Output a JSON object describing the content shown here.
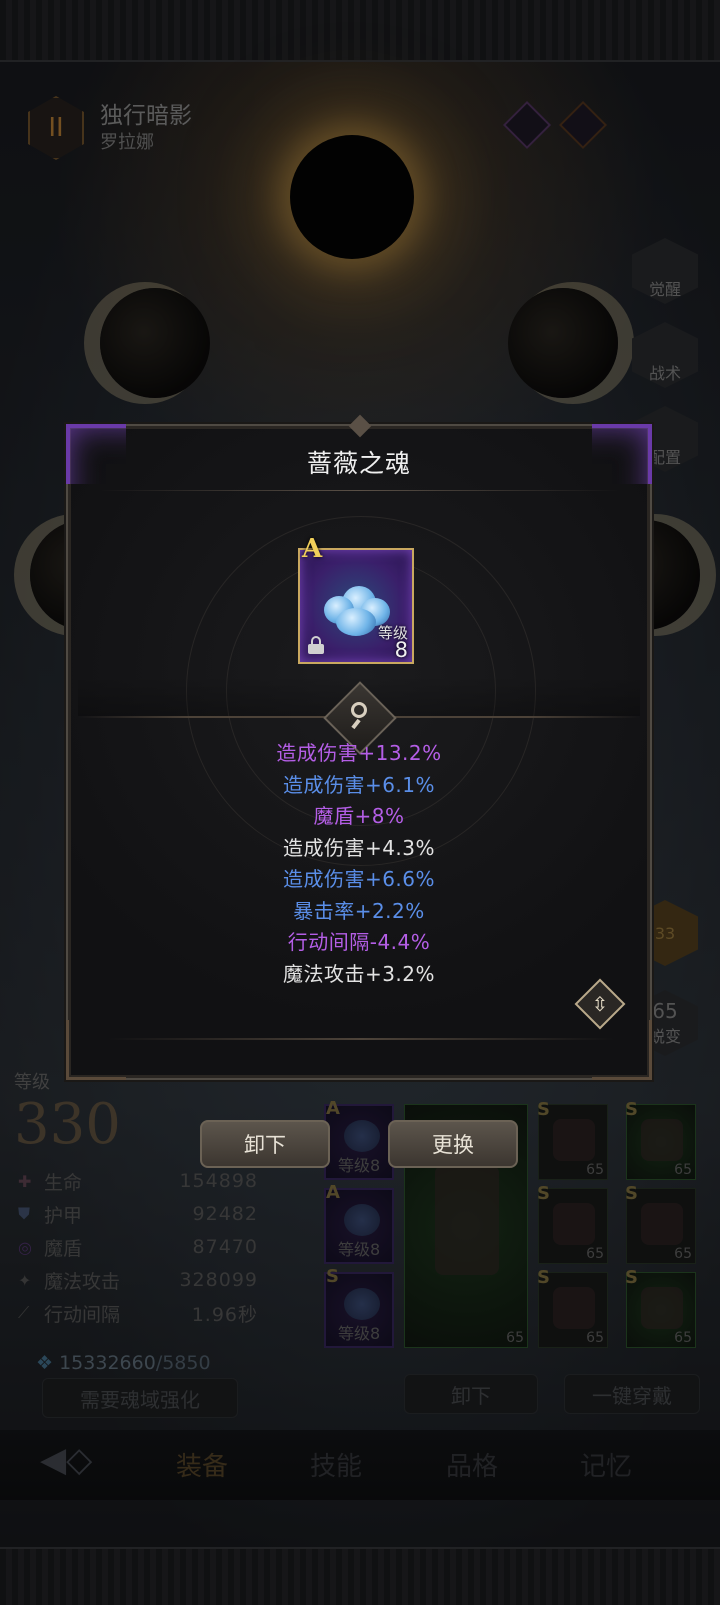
{
  "hero": {
    "title": "独行暗影",
    "subtitle": "罗拉娜",
    "class_numeral": "II"
  },
  "side_buttons": [
    "觉醒",
    "战术",
    "配置"
  ],
  "side_extra": {
    "badge": "33",
    "level": "65",
    "label": "蜕变"
  },
  "level": {
    "label": "等级",
    "value": "330"
  },
  "stats": [
    {
      "icon": "heart-icon",
      "name": "生命",
      "value": "154898"
    },
    {
      "icon": "shield-icon",
      "name": "护甲",
      "value": "92482"
    },
    {
      "icon": "swirl-icon",
      "name": "魔盾",
      "value": "87470"
    },
    {
      "icon": "wand-icon",
      "name": "魔法攻击",
      "value": "328099"
    },
    {
      "icon": "speed-icon",
      "name": "行动间隔",
      "value": "1.96秒"
    }
  ],
  "currency": {
    "amount": "15332660",
    "separator": "/",
    "cost": "5850"
  },
  "buttons": {
    "soul_upgrade": "需要魂域强化",
    "unequip_all": "卸下",
    "one_click_equip": "一键穿戴",
    "unequip": "卸下",
    "replace": "更换"
  },
  "souls": [
    {
      "rank": "A",
      "level_label": "等级8"
    },
    {
      "rank": "A",
      "level_label": "等级8"
    },
    {
      "rank": "S",
      "level_label": "等级8"
    }
  ],
  "equipment": [
    {
      "rank": "S",
      "level": "65"
    },
    {
      "rank": "S",
      "level": "65"
    },
    {
      "rank": "S",
      "level": "65"
    },
    {
      "rank": "S",
      "level": "65"
    },
    {
      "rank": "S",
      "level": "65"
    },
    {
      "rank": "S",
      "level": "65"
    }
  ],
  "main_equip_level": "65",
  "tabs": [
    "装备",
    "技能",
    "品格",
    "记忆"
  ],
  "modal": {
    "title": "蔷薇之魂",
    "item": {
      "rank": "A",
      "level_label": "等级",
      "level_value": "8"
    },
    "attributes": [
      {
        "text": "造成伤害+13.2%",
        "color": "#b45ee6"
      },
      {
        "text": "造成伤害+6.1%",
        "color": "#5a8ee8"
      },
      {
        "text": "魔盾+8%",
        "color": "#b45ee6"
      },
      {
        "text": "造成伤害+4.3%",
        "color": "#e2e2e2"
      },
      {
        "text": "造成伤害+6.6%",
        "color": "#5a8ee8"
      },
      {
        "text": "暴击率+2.2%",
        "color": "#5a8ee8"
      },
      {
        "text": "行动间隔-4.4%",
        "color": "#b45ee6"
      },
      {
        "text": "魔法攻击+3.2%",
        "color": "#e2e2e2"
      }
    ]
  }
}
